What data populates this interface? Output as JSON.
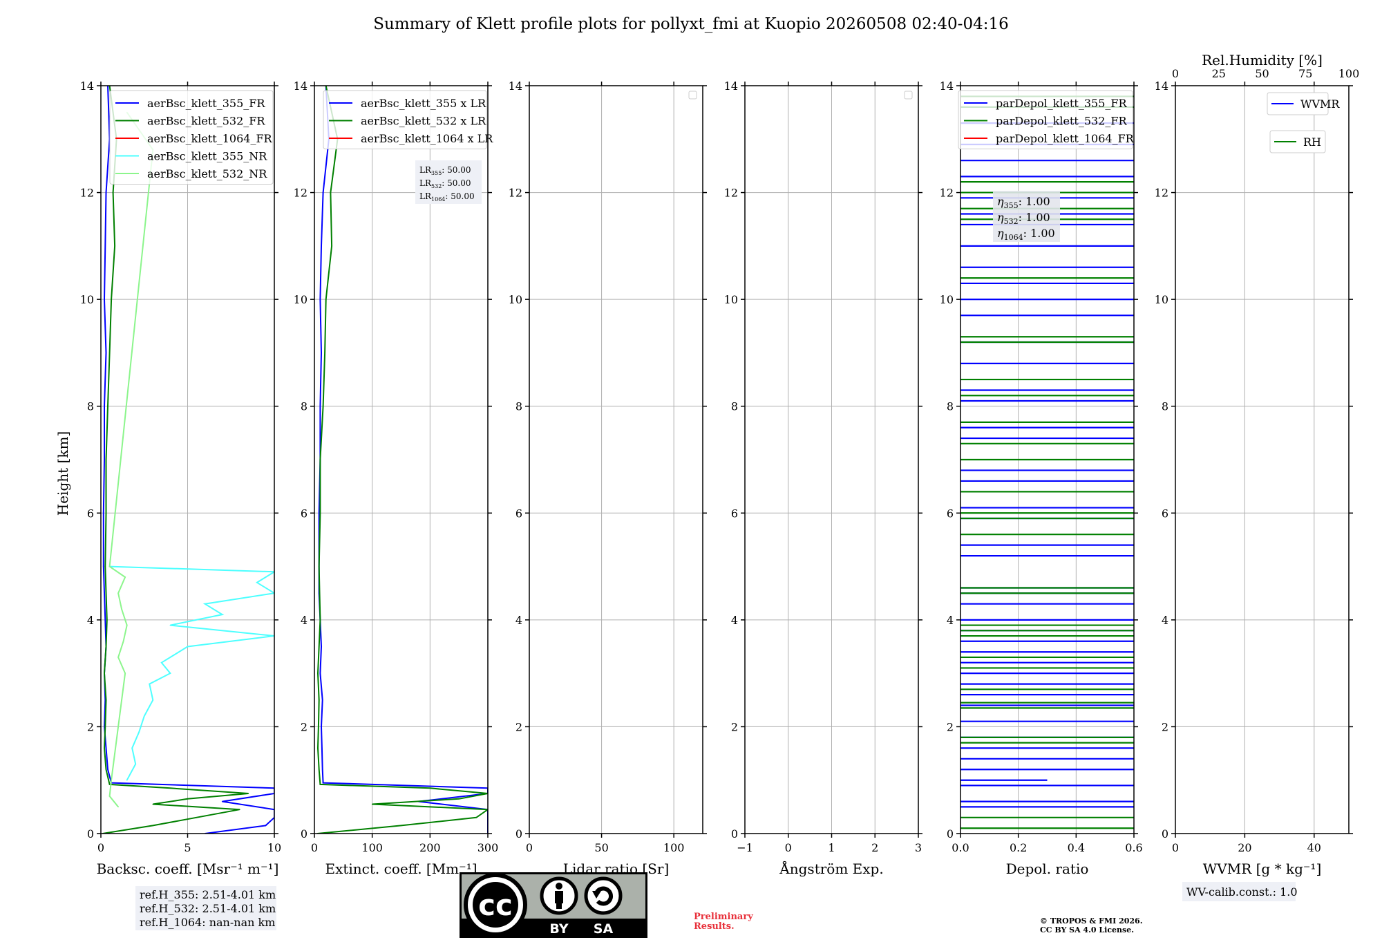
{
  "title": "Summary of Klett profile plots for pollyxt_fmi at Kuopio 20260508 02:40-04:16",
  "shared_ylabel": "Height [km]",
  "colors": {
    "blue": "#0000ff",
    "green": "#008000",
    "red": "#ff0000",
    "cyan": "#4dffff",
    "lightgreen": "#8cf58c",
    "grid": "#b0b0b0"
  },
  "chart_data": [
    {
      "type": "line",
      "panel": "backscatter",
      "xlabel": "Backsc. coeff. [Msr⁻¹ m⁻¹]",
      "xlim": [
        0,
        10
      ],
      "xticks": [
        0,
        5,
        10
      ],
      "ylim": [
        0,
        14
      ],
      "yticks": [
        0,
        2,
        4,
        6,
        8,
        10,
        12,
        14
      ],
      "grid": true,
      "legend_position": "upper-right",
      "series": [
        {
          "name": "aerBsc_klett_355_FR",
          "color": "#0000ff",
          "y": [
            0.0,
            0.15,
            0.3,
            0.45,
            0.6,
            0.75,
            0.85,
            0.95,
            1.2,
            1.6,
            2.0,
            2.5,
            3.0,
            3.5,
            4.0,
            4.5,
            5.0,
            6.0,
            7.0,
            8.0,
            9.0,
            10.0,
            11.0,
            12.0,
            13.0,
            14.0
          ],
          "x": [
            6.0,
            9.5,
            10.0,
            10.0,
            7.0,
            10.0,
            10.0,
            0.6,
            0.4,
            0.3,
            0.2,
            0.25,
            0.2,
            0.3,
            0.25,
            0.2,
            0.15,
            0.15,
            0.2,
            0.2,
            0.3,
            0.2,
            0.25,
            0.3,
            0.5,
            0.4
          ]
        },
        {
          "name": "aerBsc_klett_532_FR",
          "color": "#008000",
          "y": [
            0.0,
            0.15,
            0.3,
            0.45,
            0.55,
            0.65,
            0.75,
            0.85,
            0.92,
            1.2,
            1.6,
            2.0,
            2.5,
            3.0,
            3.5,
            4.0,
            4.5,
            5.0,
            6.0,
            7.0,
            8.0,
            9.0,
            10.0,
            11.0,
            12.0,
            13.0,
            14.0
          ],
          "x": [
            0.1,
            3.0,
            5.5,
            8.0,
            3.0,
            5.0,
            8.5,
            4.0,
            0.5,
            0.3,
            0.2,
            0.25,
            0.3,
            0.2,
            0.3,
            0.35,
            0.3,
            0.25,
            0.3,
            0.3,
            0.4,
            0.5,
            0.6,
            0.8,
            0.7,
            0.9,
            0.5
          ]
        },
        {
          "name": "aerBsc_klett_1064_FR",
          "color": "#ff0000",
          "y": [],
          "x": []
        },
        {
          "name": "aerBsc_klett_355_NR",
          "color": "#4dffff",
          "y": [
            1.0,
            1.3,
            1.6,
            1.9,
            2.2,
            2.5,
            2.8,
            3.0,
            3.2,
            3.5,
            3.7,
            3.9,
            4.1,
            4.3,
            4.5,
            4.7,
            4.9,
            5.0
          ],
          "x": [
            1.5,
            2.0,
            1.8,
            2.2,
            2.5,
            3.0,
            2.8,
            4.0,
            3.5,
            5.0,
            10.0,
            4.0,
            7.0,
            6.0,
            10.0,
            9.0,
            10.0,
            0.5
          ]
        },
        {
          "name": "aerBsc_klett_532_NR",
          "color": "#8cf58c",
          "y": [
            0.5,
            0.7,
            1.0,
            1.5,
            2.0,
            2.5,
            3.0,
            3.3,
            3.6,
            3.9,
            4.2,
            4.5,
            4.8,
            5.0,
            12.8,
            13.5
          ],
          "x": [
            1.0,
            0.5,
            0.6,
            0.8,
            1.0,
            1.2,
            1.4,
            1.0,
            1.3,
            1.5,
            1.2,
            1.0,
            1.4,
            0.5,
            3.0,
            1.5
          ]
        }
      ],
      "notes": [
        "ref.H_355: 2.51-4.01 km",
        "ref.H_532: 2.51-4.01 km",
        "ref.H_1064: nan-nan km"
      ]
    },
    {
      "type": "line",
      "panel": "extinction",
      "xlabel": "Extinct. coeff. [Mm⁻¹]",
      "xlim": [
        0,
        300
      ],
      "xticks": [
        0,
        100,
        200,
        300
      ],
      "ylim": [
        0,
        14
      ],
      "yticks": [
        0,
        2,
        4,
        6,
        8,
        10,
        12,
        14
      ],
      "grid": true,
      "legend_position": "upper-right",
      "series": [
        {
          "name": "aerBsc_klett_355 x LR",
          "color": "#0000ff",
          "y": [
            0.0,
            0.15,
            0.3,
            0.45,
            0.6,
            0.75,
            0.85,
            0.95,
            1.2,
            1.6,
            2.0,
            2.5,
            3.0,
            3.5,
            4.0,
            4.5,
            5.0,
            6.0,
            7.0,
            8.0,
            9.0,
            10.0,
            11.0,
            12.0,
            13.0,
            14.0
          ],
          "x": [
            300,
            300,
            300,
            300,
            180,
            300,
            300,
            15,
            14,
            13,
            12,
            14,
            10,
            12,
            10,
            8,
            8,
            8,
            10,
            10,
            12,
            10,
            12,
            15,
            25,
            20
          ]
        },
        {
          "name": "aerBsc_klett_532 x LR",
          "color": "#008000",
          "y": [
            0.0,
            0.15,
            0.3,
            0.45,
            0.55,
            0.65,
            0.75,
            0.85,
            0.92,
            1.2,
            1.6,
            2.0,
            2.5,
            3.0,
            3.5,
            4.0,
            4.5,
            5.0,
            6.0,
            7.0,
            8.0,
            9.0,
            10.0,
            11.0,
            12.0,
            13.0,
            14.0
          ],
          "x": [
            5,
            150,
            280,
            300,
            100,
            250,
            300,
            200,
            10,
            8,
            6,
            7,
            8,
            6,
            8,
            10,
            9,
            8,
            10,
            10,
            15,
            18,
            20,
            30,
            28,
            40,
            20
          ]
        },
        {
          "name": "aerBsc_klett_1064 x LR",
          "color": "#ff0000",
          "y": [],
          "x": []
        }
      ],
      "annotation": [
        {
          "label": "LR",
          "sub": "355",
          "value": ": 50.00"
        },
        {
          "label": "LR",
          "sub": "532",
          "value": ": 50.00"
        },
        {
          "label": "LR",
          "sub": "1064",
          "value": ": 50.00"
        }
      ]
    },
    {
      "type": "line",
      "panel": "lidar_ratio",
      "xlabel": "Lidar ratio [Sr]",
      "xlim": [
        0,
        120
      ],
      "xticks": [
        0,
        50,
        100
      ],
      "ylim": [
        0,
        14
      ],
      "yticks": [
        0,
        2,
        4,
        6,
        8,
        10,
        12,
        14
      ],
      "grid": true,
      "legend_position": "upper-right",
      "series": []
    },
    {
      "type": "line",
      "panel": "angstrom",
      "xlabel": "Ångström Exp.",
      "xlim": [
        -1,
        3
      ],
      "xticks": [
        -1,
        0,
        1,
        2,
        3
      ],
      "ylim": [
        0,
        14
      ],
      "yticks": [
        0,
        2,
        4,
        6,
        8,
        10,
        12,
        14
      ],
      "grid": true,
      "legend_position": "upper-right",
      "series": []
    },
    {
      "type": "line",
      "panel": "depolarization",
      "xlabel": "Depol. ratio",
      "xlim": [
        0.0,
        0.6
      ],
      "xticks": [
        0.0,
        0.2,
        0.4,
        0.6
      ],
      "xtick_labels": [
        "0.0",
        "0.2",
        "0.4",
        "0.6"
      ],
      "ylim": [
        0,
        14
      ],
      "yticks": [
        0,
        2,
        4,
        6,
        8,
        10,
        12,
        14
      ],
      "grid": true,
      "legend_position": "upper-right",
      "series": [
        {
          "name": "parDepol_klett_355_FR",
          "color": "#0000ff",
          "y": [
            0.5,
            0.6,
            0.9,
            1.0,
            1.2,
            1.4,
            1.6,
            1.8,
            2.1,
            2.4,
            2.6,
            2.8,
            3.0,
            3.2,
            3.4,
            3.6,
            3.8,
            4.0,
            4.3,
            4.5,
            4.6,
            5.2,
            5.4,
            5.9,
            6.1,
            6.6,
            6.8,
            7.4,
            7.6,
            8.1,
            8.3,
            8.8,
            9.2,
            9.7,
            10.0,
            10.3,
            10.6,
            11.0,
            11.4,
            11.6,
            11.9,
            12.3,
            12.6,
            12.9,
            13.3,
            13.6
          ],
          "x": [
            0.6,
            0.6,
            0.6,
            0.3,
            0.6,
            0.6,
            0.6,
            0.6,
            0.6,
            0.6,
            0.6,
            0.6,
            0.6,
            0.6,
            0.6,
            0.6,
            0.6,
            0.6,
            0.6,
            0.6,
            0.6,
            0.6,
            0.6,
            0.6,
            0.6,
            0.6,
            0.6,
            0.6,
            0.6,
            0.6,
            0.6,
            0.6,
            0.6,
            0.6,
            0.6,
            0.6,
            0.6,
            0.6,
            0.6,
            0.6,
            0.6,
            0.6,
            0.6,
            0.6,
            0.6,
            0.6
          ]
        },
        {
          "name": "parDepol_klett_532_FR",
          "color": "#008000",
          "y": [
            0.1,
            0.3,
            1.7,
            1.8,
            2.35,
            2.45,
            2.7,
            3.1,
            3.3,
            3.7,
            3.8,
            3.9,
            4.5,
            4.6,
            5.6,
            5.9,
            6.0,
            6.4,
            7.0,
            7.3,
            7.7,
            8.2,
            8.5,
            9.2,
            9.3,
            10.4,
            11.5,
            11.7,
            12.0,
            12.2,
            13.6,
            13.8
          ],
          "x": [
            0.6,
            0.6,
            0.6,
            0.6,
            0.6,
            0.6,
            0.6,
            0.6,
            0.6,
            0.6,
            0.6,
            0.6,
            0.6,
            0.6,
            0.6,
            0.6,
            0.6,
            0.6,
            0.6,
            0.6,
            0.6,
            0.6,
            0.6,
            0.6,
            0.6,
            0.6,
            0.6,
            0.6,
            0.6,
            0.6,
            0.6,
            0.6
          ]
        },
        {
          "name": "parDepol_klett_1064_FR",
          "color": "#ff0000",
          "y": [],
          "x": []
        }
      ],
      "annotation": [
        {
          "label": "η",
          "sub": "355",
          "value": ": 1.00"
        },
        {
          "label": "η",
          "sub": "532",
          "value": ": 1.00"
        },
        {
          "label": "η",
          "sub": "1064",
          "value": ": 1.00"
        }
      ]
    },
    {
      "type": "line",
      "panel": "wvmr",
      "xlabel": "WVMR [g * kg⁻¹]",
      "xlim": [
        0,
        50
      ],
      "xticks": [
        0,
        20,
        40
      ],
      "top_xlabel": "Rel.Humidity [%]",
      "top_xlim": [
        0,
        100
      ],
      "top_xticks": [
        0,
        25,
        50,
        75,
        100
      ],
      "ylim": [
        0,
        14
      ],
      "yticks": [
        0,
        2,
        4,
        6,
        8,
        10,
        12,
        14
      ],
      "grid": true,
      "legend_position": "upper-right",
      "series": [
        {
          "name": "WVMR",
          "color": "#0000ff",
          "y": [],
          "x": []
        },
        {
          "name": "RH",
          "color": "#008000",
          "y": [],
          "x": []
        }
      ],
      "notes": [
        "WV-calib.const.: 1.0"
      ]
    }
  ],
  "footer": {
    "cc_text": "cc",
    "cc_by": "BY",
    "cc_sa": "SA",
    "preliminary_line1": "Preliminary",
    "preliminary_line2": "Results.",
    "copyright_line1": "© TROPOS & FMI 2026.",
    "copyright_line2": "CC BY SA 4.0 License."
  }
}
